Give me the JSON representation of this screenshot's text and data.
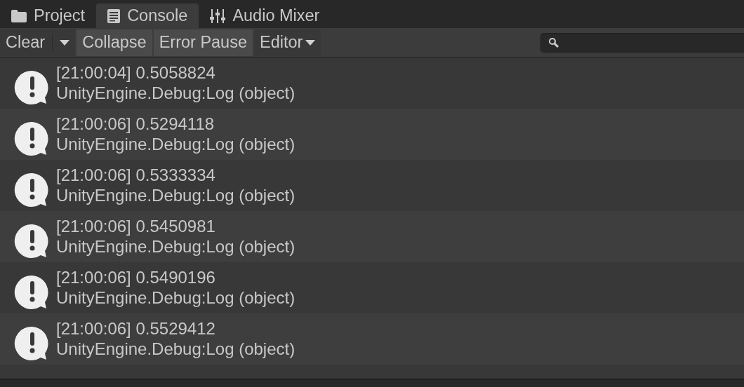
{
  "tabs": [
    {
      "label": "Project",
      "selected": false
    },
    {
      "label": "Console",
      "selected": true
    },
    {
      "label": "Audio Mixer",
      "selected": false
    }
  ],
  "toolbar": {
    "buttons": [
      {
        "label": "Clear",
        "kind": "split",
        "on": false
      },
      {
        "label": "Collapse",
        "kind": "toggle",
        "on": true
      },
      {
        "label": "Error Pause",
        "kind": "toggle",
        "on": true
      },
      {
        "label": "Editor",
        "kind": "dropdown",
        "on": false
      }
    ]
  },
  "log": [
    {
      "message": "[21:00:04] 0.5058824",
      "source": "UnityEngine.Debug:Log (object)"
    },
    {
      "message": "[21:00:06] 0.5294118",
      "source": "UnityEngine.Debug:Log (object)"
    },
    {
      "message": "[21:00:06] 0.5333334",
      "source": "UnityEngine.Debug:Log (object)"
    },
    {
      "message": "[21:00:06] 0.5450981",
      "source": "UnityEngine.Debug:Log (object)"
    },
    {
      "message": "[21:00:06] 0.5490196",
      "source": "UnityEngine.Debug:Log (object)"
    },
    {
      "message": "[21:00:06] 0.5529412",
      "source": "UnityEngine.Debug:Log (object)"
    }
  ]
}
